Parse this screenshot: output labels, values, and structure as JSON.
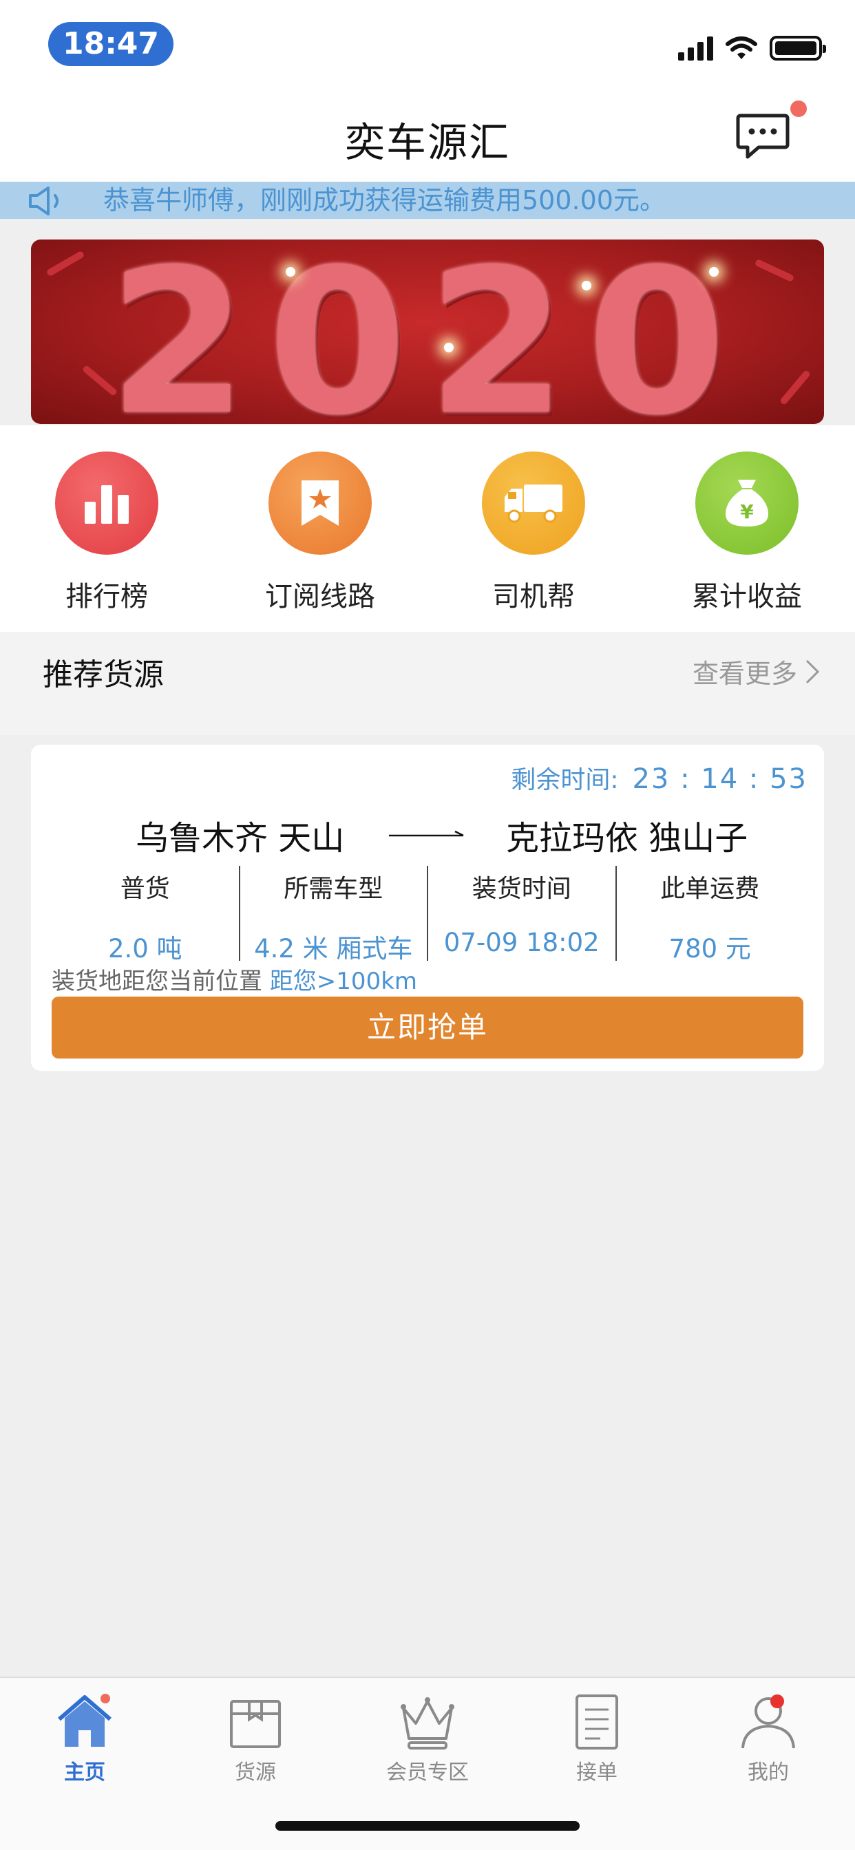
{
  "status_bar": {
    "time": "18:47"
  },
  "nav": {
    "title": "奕车源汇"
  },
  "notice": {
    "text": "恭喜牛师傅，刚刚成功获得运输费用500.00元。"
  },
  "banner": {
    "text": "2020"
  },
  "quick_menu": [
    {
      "label": "排行榜",
      "icon": "bar-chart-icon",
      "color": "#e84a4d"
    },
    {
      "label": "订阅线路",
      "icon": "bookmark-star-icon",
      "color": "#ee8a3a"
    },
    {
      "label": "司机帮",
      "icon": "truck-icon",
      "color": "#f2b02d"
    },
    {
      "label": "累计收益",
      "icon": "money-bag-icon",
      "color": "#8cc93a"
    }
  ],
  "section": {
    "title": "推荐货源",
    "see_more": "查看更多"
  },
  "card": {
    "countdown_label": "剩余时间:",
    "countdown": "23 : 14 : 53",
    "from": "乌鲁木齐 天山",
    "to": "克拉玛依 独山子",
    "details": [
      {
        "label": "普货",
        "value": "2.0 吨"
      },
      {
        "label": "所需车型",
        "value": "4.2 米 厢式车"
      },
      {
        "label": "装货时间",
        "value": "07-09 18:02"
      },
      {
        "label": "此单运费",
        "value": "780 元"
      }
    ],
    "distance_label": "装货地距您当前位置",
    "distance_value": "距您>100km",
    "button": "立即抢单"
  },
  "tabs": [
    {
      "label": "主页",
      "icon": "home-icon",
      "active": true
    },
    {
      "label": "货源",
      "icon": "cargo-box-icon",
      "active": false
    },
    {
      "label": "会员专区",
      "icon": "crown-icon",
      "active": false
    },
    {
      "label": "接单",
      "icon": "document-icon",
      "active": false
    },
    {
      "label": "我的",
      "icon": "user-icon",
      "active": false
    }
  ],
  "colors": {
    "accent_blue": "#2f6fd2",
    "link_blue": "#4b93d1",
    "button_orange": "#e1852f",
    "notice_bg": "#acd0ec"
  }
}
